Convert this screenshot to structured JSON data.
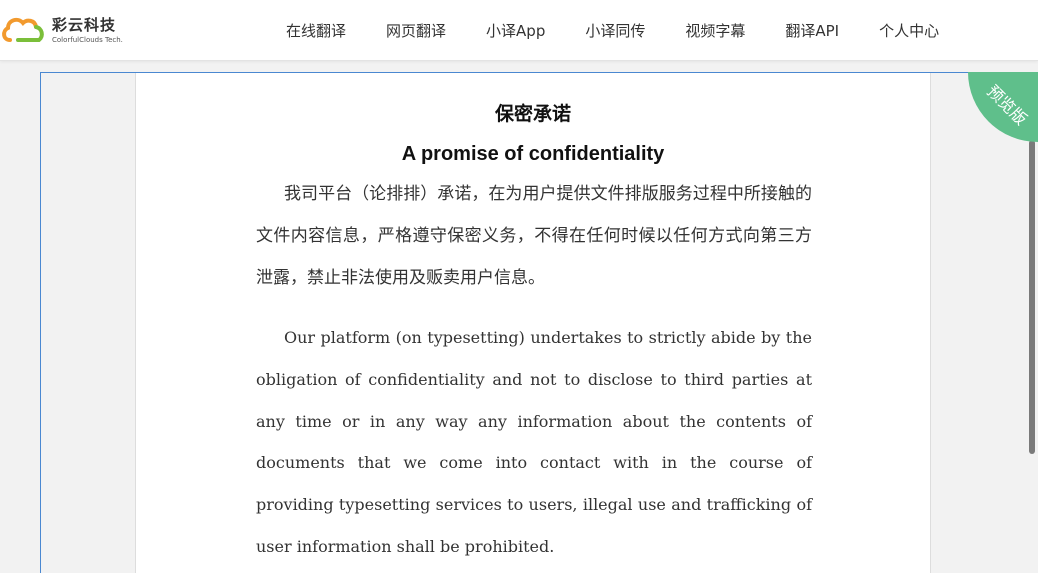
{
  "header": {
    "logo": {
      "name_cn": "彩云科技",
      "name_en": "ColorfulClouds Tech.",
      "colors": {
        "orange": "#f29a2e",
        "green": "#7bbf3a"
      }
    },
    "nav": [
      {
        "label": "在线翻译"
      },
      {
        "label": "网页翻译"
      },
      {
        "label": "小译App"
      },
      {
        "label": "小译同传"
      },
      {
        "label": "视频字幕"
      },
      {
        "label": "翻译API"
      },
      {
        "label": "个人中心"
      }
    ]
  },
  "document": {
    "title_cn": "保密承诺",
    "title_en": "A promise of confidentiality",
    "paragraph_cn": "我司平台（论排排）承诺，在为用户提供文件排版服务过程中所接触的文件内容信息，严格遵守保密义务，不得在任何时候以任何方式向第三方泄露，禁止非法使用及贩卖用户信息。",
    "paragraph_en": "Our platform (on typesetting) undertakes to strictly abide by the obligation of confidentiality and not to disclose to third parties at any time or in any way any information about the contents of documents that we come into contact with in the course of providing typesetting services to users, illegal use and trafficking of user information shall be prohibited."
  },
  "badge": {
    "label": "预览版",
    "color": "#5fbf8b"
  }
}
